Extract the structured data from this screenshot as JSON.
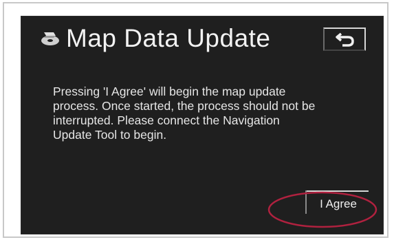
{
  "dialog": {
    "title": "Map Data Update",
    "title_icon": "map-disc-icon",
    "back_icon": "return-arrow-icon",
    "message": "Pressing 'I Agree' will begin the map update\nprocess.  Once started, the process should not be\ninterrupted.  Please connect the Navigation\nUpdate Tool to begin.",
    "agree_label": "I Agree"
  },
  "colors": {
    "screen_background": "#1f1f1f",
    "text": "#eeeeee",
    "highlight": "#b0213f"
  }
}
